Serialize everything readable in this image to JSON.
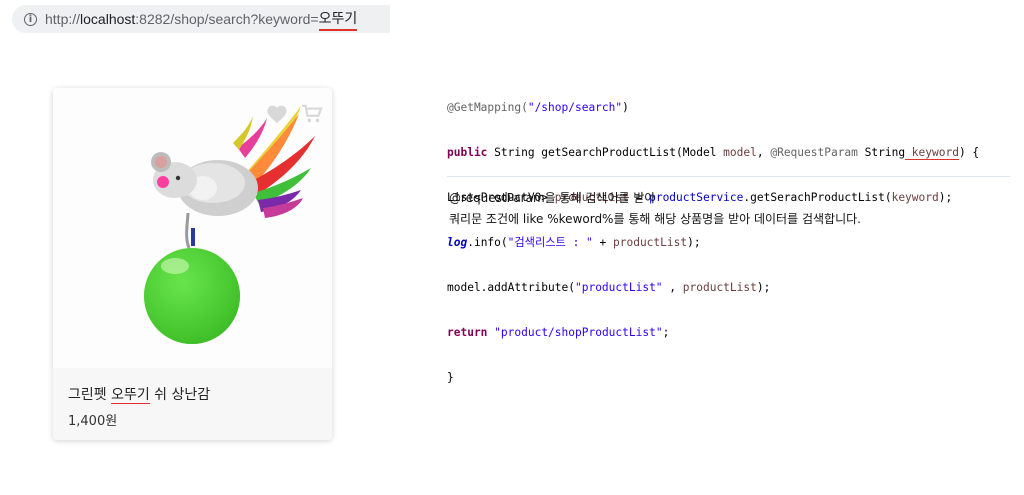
{
  "browser": {
    "url_prefix": "http://",
    "url_host": "localhost",
    "url_path": ":8282/shop/search?keyword=",
    "url_keyword": "오뚜기"
  },
  "product": {
    "name_prefix": "그린펫 ",
    "name_highlight": "오뚜기",
    "name_suffix": " 쉬 상난감",
    "price": "1,400원"
  },
  "code": {
    "line1_annotation": "@GetMapping(",
    "line1_string": "\"/shop/search\"",
    "line1_end": ")",
    "line2_kw": "public",
    "line2_a": " String getSearchProductList(Model ",
    "line2_var1": "model",
    "line2_b": ", ",
    "line2_ann": "@RequestParam",
    "line2_c": " String",
    "line2_var2": " keyword",
    "line2_end": ") {",
    "line3_a": "List<ProductVO> ",
    "line3_var": "productList",
    "line3_b": " = ",
    "line3_field": "productService",
    "line3_c": ".getSerachProductList(",
    "line3_var2": "keyword",
    "line3_end": ");",
    "line4_log": "log",
    "line4_a": ".info(",
    "line4_string": "\"검색리스트 : \"",
    "line4_b": " + ",
    "line4_var": "productList",
    "line4_end": ");",
    "line5_a": "model.addAttribute(",
    "line5_string": "\"productList\"",
    "line5_b": " , ",
    "line5_var": "productList",
    "line5_end": ");",
    "line6_kw": "return",
    "line6_a": " ",
    "line6_string": "\"product/shopProductList\"",
    "line6_end": ";",
    "line7": "}"
  },
  "description": {
    "line1": "@requestParam을 통해 검색어를 받아",
    "line2": "쿼리문 조건에 like %keword%를 통해 해당 상품명을 받아 데이터를 검색합니다."
  },
  "colors": {
    "highlight_underline": "#e0302c",
    "ball_green": "#4fd834",
    "icon_gray": "#d8d8d8"
  }
}
